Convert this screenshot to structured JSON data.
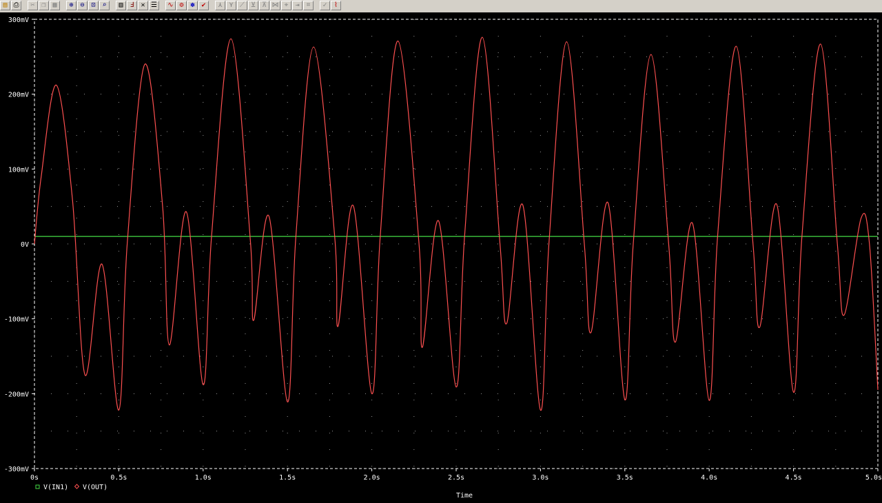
{
  "toolbar": {
    "groups": [
      {
        "name": "file",
        "buttons": [
          {
            "name": "open-icon",
            "glyph": "▤",
            "color": "#c08000"
          },
          {
            "name": "print-icon",
            "glyph": "⎙",
            "color": "#000000"
          }
        ]
      },
      {
        "name": "edit",
        "buttons": [
          {
            "name": "cut-icon",
            "glyph": "✂",
            "color": "#808080"
          },
          {
            "name": "copy-icon",
            "glyph": "❐",
            "color": "#808080"
          },
          {
            "name": "paste-icon",
            "glyph": "▦",
            "color": "#808080"
          }
        ]
      },
      {
        "name": "zoom",
        "buttons": [
          {
            "name": "zoom-in-icon",
            "glyph": "⊕",
            "color": "#000080"
          },
          {
            "name": "zoom-out-icon",
            "glyph": "⊖",
            "color": "#000080"
          },
          {
            "name": "zoom-area-icon",
            "glyph": "⊡",
            "color": "#000080"
          },
          {
            "name": "zoom-fit-icon",
            "glyph": "⌕",
            "color": "#000080"
          }
        ]
      },
      {
        "name": "plot",
        "buttons": [
          {
            "name": "log-x-icon",
            "glyph": "▥",
            "color": "#000000"
          },
          {
            "name": "fourier-icon",
            "glyph": "Ⅎ",
            "color": "#800000"
          },
          {
            "name": "performance-icon",
            "glyph": "✕",
            "color": "#000000"
          },
          {
            "name": "table-icon",
            "glyph": "☰",
            "color": "#000000"
          }
        ]
      },
      {
        "name": "trace",
        "buttons": [
          {
            "name": "add-trace-icon",
            "glyph": "∿",
            "color": "#c00000"
          },
          {
            "name": "eval-goal-icon",
            "glyph": "⚙",
            "color": "#c00000"
          },
          {
            "name": "color-icon",
            "glyph": "✽",
            "color": "#0000c0"
          },
          {
            "name": "mark-icon",
            "glyph": "✔",
            "color": "#c00000"
          }
        ]
      },
      {
        "name": "cursor",
        "buttons": [
          {
            "name": "cursor-peak-icon",
            "glyph": "⋏",
            "color": "#808080"
          },
          {
            "name": "cursor-trough-icon",
            "glyph": "⋎",
            "color": "#808080"
          },
          {
            "name": "cursor-slope-icon",
            "glyph": "⟋",
            "color": "#808080"
          },
          {
            "name": "cursor-min-icon",
            "glyph": "⊻",
            "color": "#808080"
          },
          {
            "name": "cursor-max-icon",
            "glyph": "⊼",
            "color": "#808080"
          },
          {
            "name": "cursor-point-icon",
            "glyph": "⋈",
            "color": "#808080"
          },
          {
            "name": "cursor-search-icon",
            "glyph": "⌖",
            "color": "#808080"
          },
          {
            "name": "cursor-next-icon",
            "glyph": "⇥",
            "color": "#808080"
          },
          {
            "name": "cursor-label-icon",
            "glyph": "⌗",
            "color": "#808080"
          }
        ]
      },
      {
        "name": "markers",
        "buttons": [
          {
            "name": "mark-label-icon",
            "glyph": "✓",
            "color": "#808080"
          },
          {
            "name": "mark-data-icon",
            "glyph": "⌇",
            "color": "#c00000"
          }
        ]
      }
    ]
  },
  "chart_data": {
    "type": "line",
    "title": "",
    "xlabel": "Time",
    "ylabel": "",
    "xlim": [
      0,
      5.0
    ],
    "ylim": [
      -300,
      300
    ],
    "x_unit": "s",
    "y_unit": "mV",
    "x_ticks": [
      {
        "value": 0,
        "label": "0s"
      },
      {
        "value": 0.5,
        "label": "0.5s"
      },
      {
        "value": 1.0,
        "label": "1.0s"
      },
      {
        "value": 1.5,
        "label": "1.5s"
      },
      {
        "value": 2.0,
        "label": "2.0s"
      },
      {
        "value": 2.5,
        "label": "2.5s"
      },
      {
        "value": 3.0,
        "label": "3.0s"
      },
      {
        "value": 3.5,
        "label": "3.5s"
      },
      {
        "value": 4.0,
        "label": "4.0s"
      },
      {
        "value": 4.5,
        "label": "4.5s"
      },
      {
        "value": 5.0,
        "label": "5.0s"
      }
    ],
    "y_ticks": [
      {
        "value": 300,
        "label": "300mV"
      },
      {
        "value": 200,
        "label": "200mV"
      },
      {
        "value": 100,
        "label": "100mV"
      },
      {
        "value": 0,
        "label": "0V"
      },
      {
        "value": -100,
        "label": "-100mV"
      },
      {
        "value": -200,
        "label": "-200mV"
      },
      {
        "value": -300,
        "label": "-300mV"
      }
    ],
    "grid": true,
    "background": "#000000",
    "axis_color": "#ffffff",
    "legend_position": "bottom-left",
    "series": [
      {
        "name": "V(IN1)",
        "color": "#44dd44",
        "marker": "square",
        "x": [
          0,
          5.0
        ],
        "y": [
          10,
          10
        ]
      },
      {
        "name": "V(OUT)",
        "color": "#ff5050",
        "marker": "diamond",
        "x": [
          0.0,
          0.04,
          0.13,
          0.225,
          0.3,
          0.4,
          0.5,
          0.55,
          0.655,
          0.76,
          0.8,
          0.9,
          1.0,
          1.05,
          1.165,
          1.28,
          1.3,
          1.39,
          1.5,
          1.55,
          1.655,
          1.78,
          1.8,
          1.89,
          2.0,
          2.05,
          2.155,
          2.28,
          2.3,
          2.395,
          2.5,
          2.55,
          2.655,
          2.76,
          2.8,
          2.895,
          3.0,
          3.05,
          3.155,
          3.26,
          3.3,
          3.4,
          3.5,
          3.55,
          3.655,
          3.76,
          3.8,
          3.9,
          4.0,
          4.05,
          4.16,
          4.26,
          4.3,
          4.4,
          4.5,
          4.55,
          4.66,
          4.76,
          4.8,
          4.9,
          4.95,
          5.0
        ],
        "y": [
          0,
          90,
          212,
          60,
          -175,
          -27,
          -222,
          0,
          240,
          50,
          -135,
          43,
          -188,
          10,
          274,
          5,
          -102,
          37,
          -211,
          10,
          263,
          10,
          -110,
          51,
          -200,
          10,
          271,
          0,
          -138,
          31,
          -191,
          10,
          276,
          0,
          -106,
          52,
          -222,
          0,
          270,
          0,
          -118,
          55,
          -208,
          0,
          253,
          0,
          -131,
          28,
          -209,
          10,
          264,
          0,
          -111,
          53,
          -198,
          10,
          267,
          0,
          -95,
          34,
          0,
          -195
        ]
      }
    ]
  }
}
